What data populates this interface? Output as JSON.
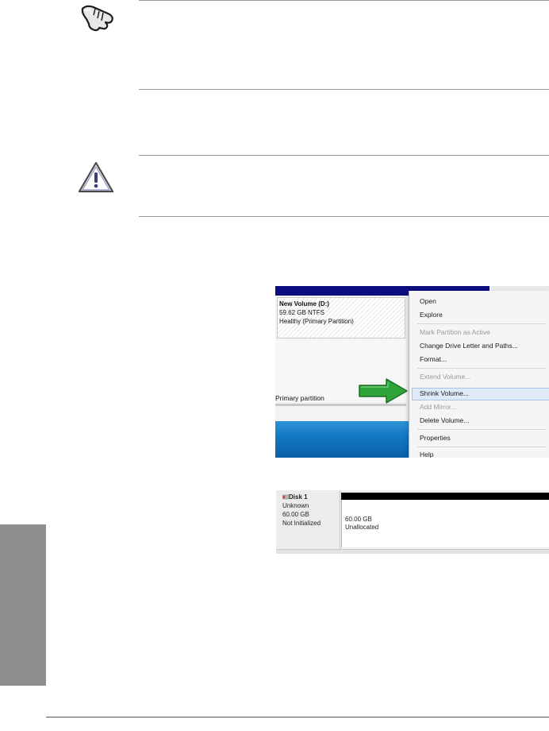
{
  "notes": {
    "note_icon": "hand-pointing-icon",
    "caution_icon": "warning-triangle-icon"
  },
  "context_screenshot": {
    "volume": {
      "name": "New Volume  (D:)",
      "size": "59.62 GB NTFS",
      "status": "Healthy (Primary Partition)"
    },
    "legend_label": "Primary partition",
    "menu": {
      "open": "Open",
      "explore": "Explore",
      "mark_active": "Mark Partition as Active",
      "change_letter": "Change Drive Letter and Paths...",
      "format": "Format...",
      "extend": "Extend Volume...",
      "shrink": "Shrink Volume...",
      "add_mirror": "Add Mirror...",
      "delete": "Delete Volume...",
      "properties": "Properties",
      "help": "Help"
    },
    "arrow_color": "#2fa43a"
  },
  "disk_screenshot": {
    "disk_label": "Disk 1",
    "type": "Unknown",
    "capacity": "60.00 GB",
    "state": "Not Initialized",
    "region_size": "60.00 GB",
    "region_status": "Unallocated"
  },
  "colors": {
    "side_tab": "#8f8f8f",
    "title_bar": "#0c0c7e"
  }
}
